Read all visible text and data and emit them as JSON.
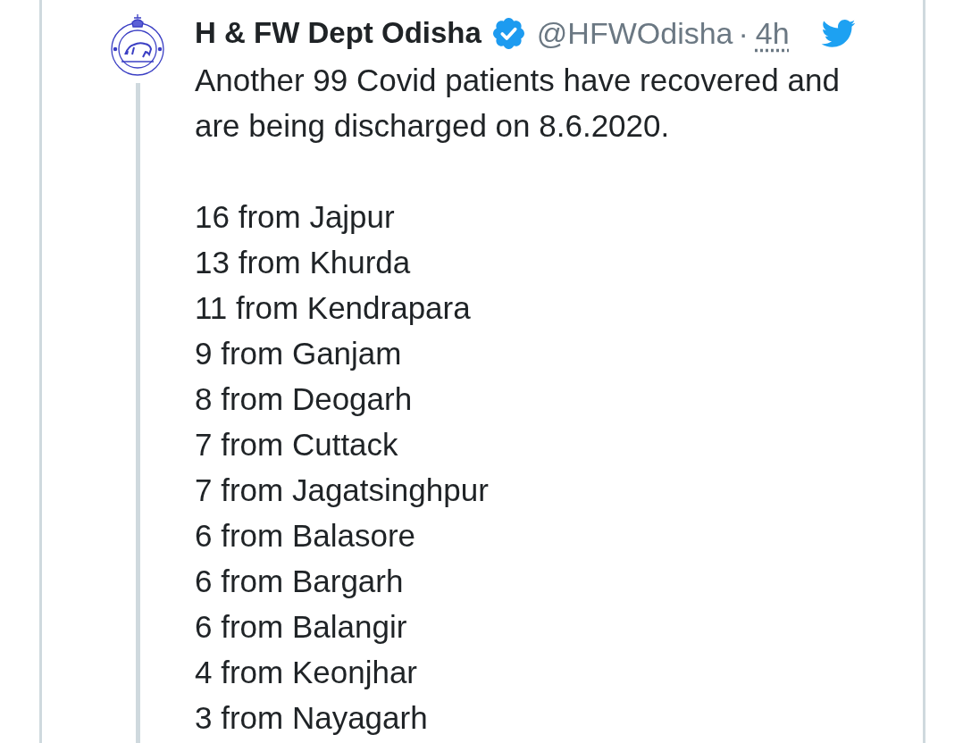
{
  "tweet": {
    "author": {
      "name": "H & FW Dept Odisha",
      "verified": true,
      "handle": "@HFWOdisha",
      "separator": "·",
      "time": "4h"
    },
    "text": "Another 99 Covid patients have recovered and are being discharged on 8.6.2020.",
    "list": [
      "16 from Jajpur",
      "13 from Khurda",
      "11 from Kendrapara",
      "9 from Ganjam",
      "8 from Deogarh",
      "7 from Cuttack",
      "7 from Jagatsinghpur",
      "6 from Balasore",
      "6 from Bargarh",
      "6 from Balangir",
      "4 from Keonjhar",
      "3 from Nayagarh"
    ]
  }
}
